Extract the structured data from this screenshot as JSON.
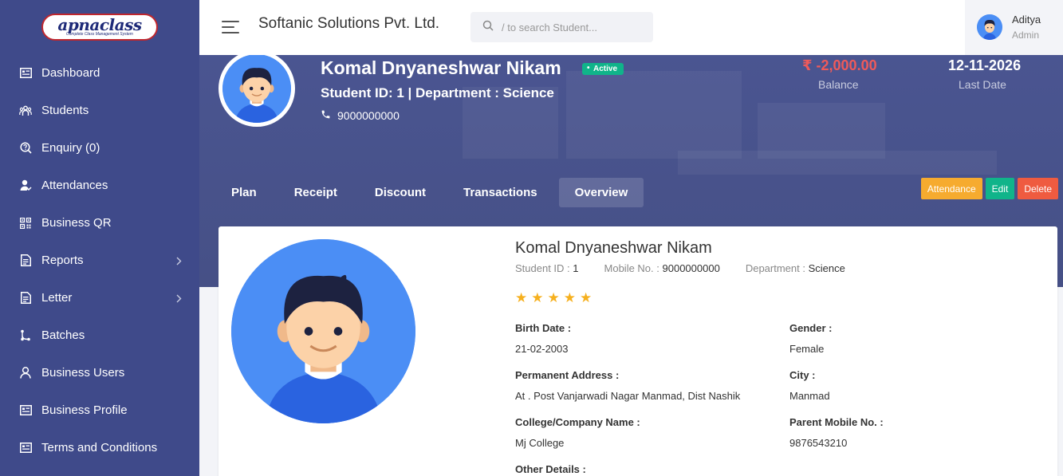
{
  "brand": {
    "logo_main": "apnaclass",
    "logo_sub": "Complete Class Management System"
  },
  "sidebar": {
    "items": [
      {
        "label": "Dashboard",
        "icon": "dashboard-icon"
      },
      {
        "label": "Students",
        "icon": "students-icon"
      },
      {
        "label": "Enquiry (0)",
        "icon": "enquiry-icon"
      },
      {
        "label": "Attendances",
        "icon": "attendance-icon"
      },
      {
        "label": "Business QR",
        "icon": "qr-icon"
      },
      {
        "label": "Reports",
        "icon": "reports-icon",
        "has_children": true
      },
      {
        "label": "Letter",
        "icon": "letter-icon",
        "has_children": true
      },
      {
        "label": "Batches",
        "icon": "batches-icon"
      },
      {
        "label": "Business Users",
        "icon": "user-icon"
      },
      {
        "label": "Business Profile",
        "icon": "profile-icon"
      },
      {
        "label": "Terms and Conditions",
        "icon": "terms-icon"
      }
    ]
  },
  "header": {
    "company": "Softanic Solutions Pvt. Ltd.",
    "search_placeholder": "/ to search Student...",
    "user_name": "Aditya",
    "user_role": "Admin"
  },
  "banner": {
    "name": "Komal Dnyaneshwar Nikam",
    "status": "Active",
    "sub": "Student ID: 1  | Department : Science",
    "phone": "9000000000",
    "balance_value": "₹ -2,000.00",
    "balance_label": "Balance",
    "last_date_value": "12-11-2026",
    "last_date_label": "Last Date"
  },
  "tabs": [
    "Plan",
    "Receipt",
    "Discount",
    "Transactions",
    "Overview"
  ],
  "active_tab": "Overview",
  "actions": {
    "attendance": "Attendance",
    "edit": "Edit",
    "delete": "Delete"
  },
  "profile": {
    "name": "Komal Dnyaneshwar Nikam",
    "student_id_label": "Student ID :",
    "student_id": "1",
    "mobile_label": "Mobile No. :",
    "mobile": "9000000000",
    "department_label": "Department :",
    "department": "Science",
    "rating": 5,
    "fields": {
      "birth_date_label": "Birth Date :",
      "birth_date": "21-02-2003",
      "gender_label": "Gender :",
      "gender": "Female",
      "address_label": "Permanent Address :",
      "address": "At . Post Vanjarwadi Nagar Manmad, Dist Nashik",
      "city_label": "City :",
      "city": "Manmad",
      "college_label": "College/Company Name :",
      "college": "Mj College",
      "parent_mobile_label": "Parent Mobile No. :",
      "parent_mobile": "9876543210",
      "other_label": "Other Details :"
    }
  },
  "colors": {
    "sidebar": "#3f4a8a",
    "balance": "#ef5a5a",
    "active": "#10b48a",
    "attendance": "#f6ab2f",
    "delete": "#ef5b40"
  }
}
